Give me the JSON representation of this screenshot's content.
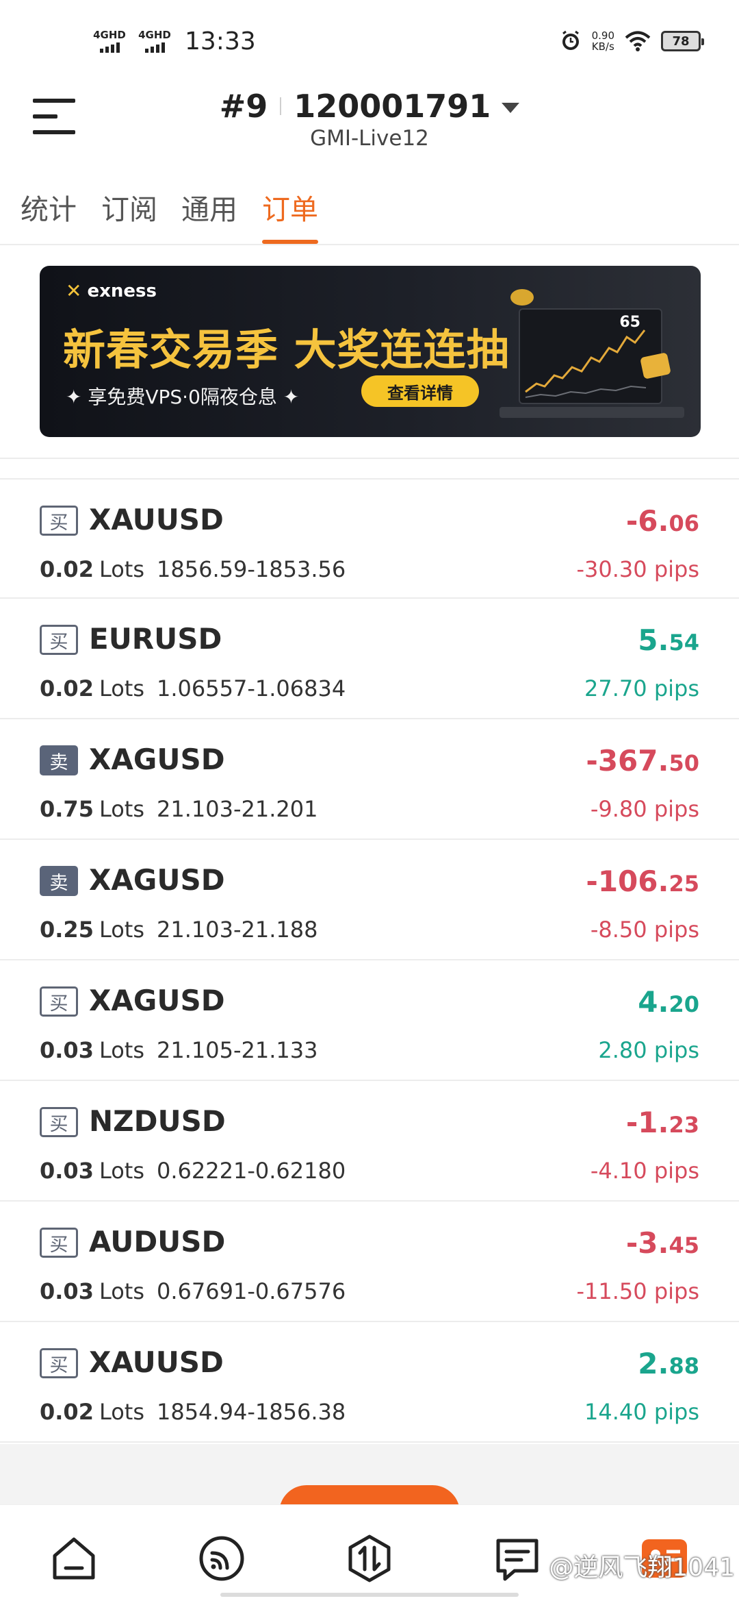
{
  "status_bar": {
    "net1": "4GHD",
    "net2": "4GHD",
    "time": "13:33",
    "speed_value": "0.90",
    "speed_unit": "KB/s",
    "battery": "78"
  },
  "header": {
    "account_prefix": "#9",
    "account_number": "120001791",
    "server": "GMI-Live12"
  },
  "tabs": [
    {
      "label": "统计"
    },
    {
      "label": "订阅"
    },
    {
      "label": "通用"
    },
    {
      "label": "订单"
    }
  ],
  "banner": {
    "brand": "exness",
    "headline": "新春交易季 大奖连连抽",
    "subtitle": "✦ 享免费VPS·0隔夜仓息 ✦",
    "cta": "查看详情",
    "score": "65"
  },
  "orders": [
    {
      "side": "买",
      "symbol": "XAUUSD",
      "lots": "0.02",
      "unit": "Lots",
      "range": "1856.59-1853.56",
      "pnl_int": "-6.",
      "pnl_dec": "06",
      "pips": "-30.30 pips",
      "direction": "negative"
    },
    {
      "side": "买",
      "symbol": "EURUSD",
      "lots": "0.02",
      "unit": "Lots",
      "range": "1.06557-1.06834",
      "pnl_int": "5.",
      "pnl_dec": "54",
      "pips": "27.70 pips",
      "direction": "positive"
    },
    {
      "side": "卖",
      "symbol": "XAGUSD",
      "lots": "0.75",
      "unit": "Lots",
      "range": "21.103-21.201",
      "pnl_int": "-367.",
      "pnl_dec": "50",
      "pips": "-9.80 pips",
      "direction": "negative"
    },
    {
      "side": "卖",
      "symbol": "XAGUSD",
      "lots": "0.25",
      "unit": "Lots",
      "range": "21.103-21.188",
      "pnl_int": "-106.",
      "pnl_dec": "25",
      "pips": "-8.50 pips",
      "direction": "negative"
    },
    {
      "side": "买",
      "symbol": "XAGUSD",
      "lots": "0.03",
      "unit": "Lots",
      "range": "21.105-21.133",
      "pnl_int": "4.",
      "pnl_dec": "20",
      "pips": "2.80 pips",
      "direction": "positive"
    },
    {
      "side": "买",
      "symbol": "NZDUSD",
      "lots": "0.03",
      "unit": "Lots",
      "range": "0.62221-0.62180",
      "pnl_int": "-1.",
      "pnl_dec": "23",
      "pips": "-4.10 pips",
      "direction": "negative"
    },
    {
      "side": "买",
      "symbol": "AUDUSD",
      "lots": "0.03",
      "unit": "Lots",
      "range": "0.67691-0.67576",
      "pnl_int": "-3.",
      "pnl_dec": "45",
      "pips": "-11.50 pips",
      "direction": "negative"
    },
    {
      "side": "买",
      "symbol": "XAUUSD",
      "lots": "0.02",
      "unit": "Lots",
      "range": "1854.94-1856.38",
      "pnl_int": "2.",
      "pnl_dec": "88",
      "pips": "14.40 pips",
      "direction": "positive"
    }
  ],
  "bottom_nav": [
    {
      "icon": "home-icon"
    },
    {
      "icon": "signal-icon"
    },
    {
      "icon": "trade-icon"
    },
    {
      "icon": "messages-icon"
    },
    {
      "icon": "profile-icon"
    }
  ],
  "watermark": "@逆风飞翔1041",
  "colors": {
    "accent": "#ee6a1f",
    "loss": "#d64a5c",
    "profit": "#1aa58d",
    "sell_badge": "#5a6479"
  }
}
